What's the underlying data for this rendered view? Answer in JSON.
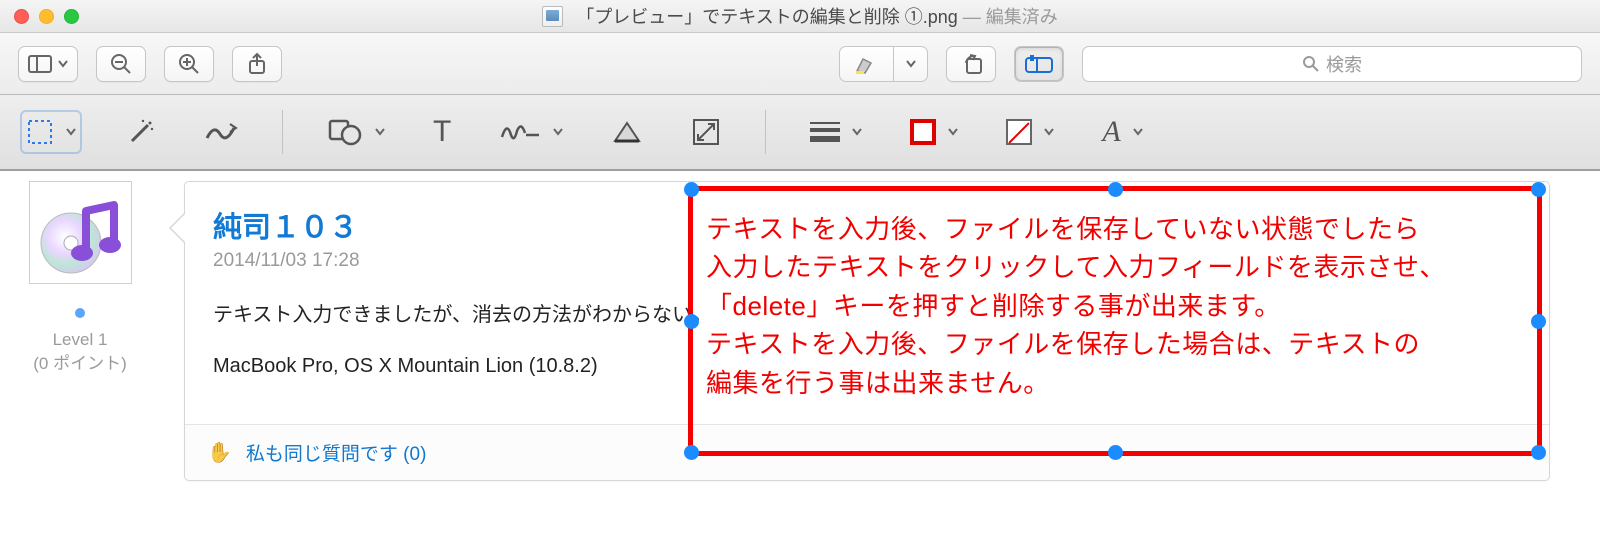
{
  "window": {
    "title_filename": "「プレビュー」でテキストの編集と削除 ①.png",
    "title_status": "— 編集済み"
  },
  "toolbar": {
    "sidebar_label": "sidebar",
    "zoom_out_label": "zoom-out",
    "zoom_in_label": "zoom-in",
    "share_label": "share",
    "highlighter_label": "highlighter",
    "rotate_label": "rotate",
    "markup_label": "markup-toolbox",
    "search_placeholder": "検索"
  },
  "markup": {
    "selection_label": "rectangular-selection",
    "instant_alpha_label": "instant-alpha",
    "sketch_label": "sketch",
    "shapes_label": "shapes",
    "text_label": "text",
    "sign_label": "sign",
    "adjust_color_label": "adjust-color",
    "adjust_size_label": "adjust-size",
    "line_style_label": "line-style",
    "border_color_label": "border-color",
    "fill_color_label": "fill-color",
    "font_style_label": "font-style",
    "border_color_value": "#e10000",
    "fill_color_value": "none"
  },
  "post": {
    "author": "純司１０３",
    "timestamp": "2014/11/03 17:28",
    "body": "テキスト入力できましたが、消去の方法がわからない。",
    "system": "MacBook Pro, OS X Mountain Lion (10.8.2)",
    "avatar_alt": "iTunes icon avatar",
    "level_label": "Level 1",
    "points_label": "(0 ポイント)",
    "same_question_label": "私も同じ質問です (0)"
  },
  "annotation": {
    "lines": [
      "テキストを入力後、ファイルを保存していない状態でしたら",
      "入力したテキストをクリックして入力フィールドを表示させ、",
      "「delete」キーを押すと削除する事が出来ます。",
      "テキストを入力後、ファイルを保存した場合は、テキストの",
      "編集を行う事は出来ません。"
    ],
    "border_color": "#f40000",
    "handle_color": "#1a8cff"
  }
}
